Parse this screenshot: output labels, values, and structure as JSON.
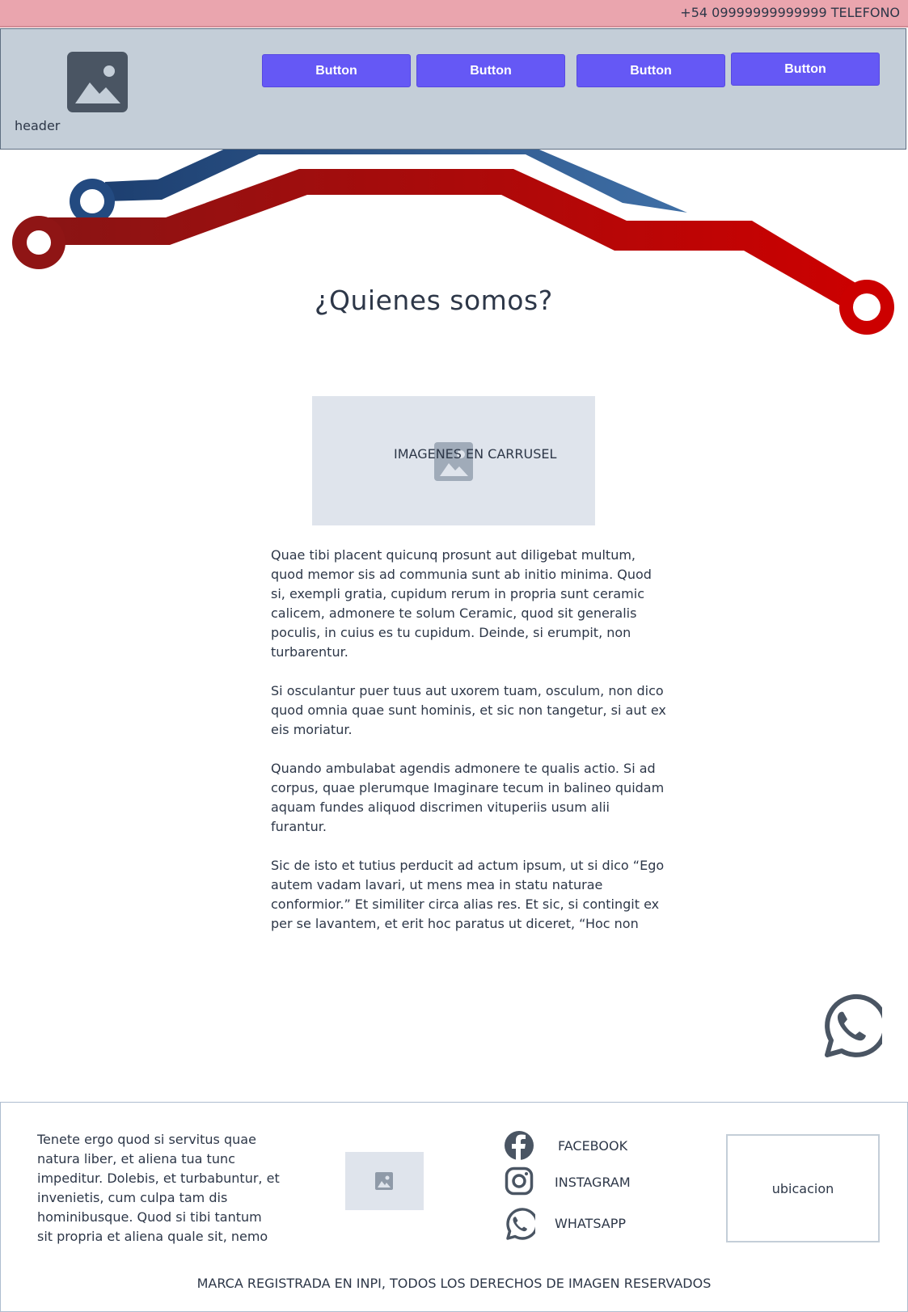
{
  "topbar": {
    "phone": "+54 09999999999999 TELEFONO"
  },
  "header": {
    "label": "header",
    "buttons": [
      "Button",
      "Button",
      "Button",
      "Button"
    ]
  },
  "main": {
    "title": "¿Quienes somos?",
    "carousel_label": "IMAGENES EN CARRUSEL",
    "paragraphs": [
      "Quae tibi placent quicunq prosunt aut diligebat multum, quod memor sis ad communia sunt ab initio minima. Quod si, exempli gratia, cupidum rerum in propria sunt ceramic calicem, admonere te solum Ceramic, quod sit generalis poculis, in cuius es tu cupidum. Deinde, si erumpit, non turbarentur.",
      "Si osculantur puer tuus aut uxorem tuam, osculum, non dico quod omnia quae sunt hominis, et sic non tangetur, si aut ex eis moriatur.",
      "Quando ambulabat agendis admonere te qualis actio. Si ad corpus, quae plerumque Imaginare tecum in balineo quidam aquam fundes aliquod discrimen vituperiis usum alii furantur.",
      "Sic de isto et tutius perducit ad actum ipsum, ut si dico “Ego autem vadam lavari, ut mens mea in statu naturae conformior.” Et similiter circa alias res. Et sic, si contingit ex per se lavantem, et erit hoc paratus ut diceret, “Hoc non"
    ]
  },
  "footer": {
    "text": "Tenete ergo quod si servitus quae natura liber, et aliena tua tunc impeditur. Dolebis, et turbabuntur, et invenietis, cum culpa tam dis hominibusque. Quod si tibi tantum sit propria et aliena quale sit, nemo",
    "social": {
      "facebook": "FACEBOOK",
      "instagram": "INSTAGRAM",
      "whatsapp": "WHATSAPP"
    },
    "location": "ubicacion",
    "copyright": "MARCA REGISTRADA EN INPI, TODOS LOS DERECHOS DE IMAGEN RESERVADOS"
  },
  "colors": {
    "button": "#6558f5",
    "topbar": "#eaa5ae",
    "header": "#c4ced8",
    "circuit_red": "#c00000",
    "circuit_blue": "#2b5c96"
  }
}
